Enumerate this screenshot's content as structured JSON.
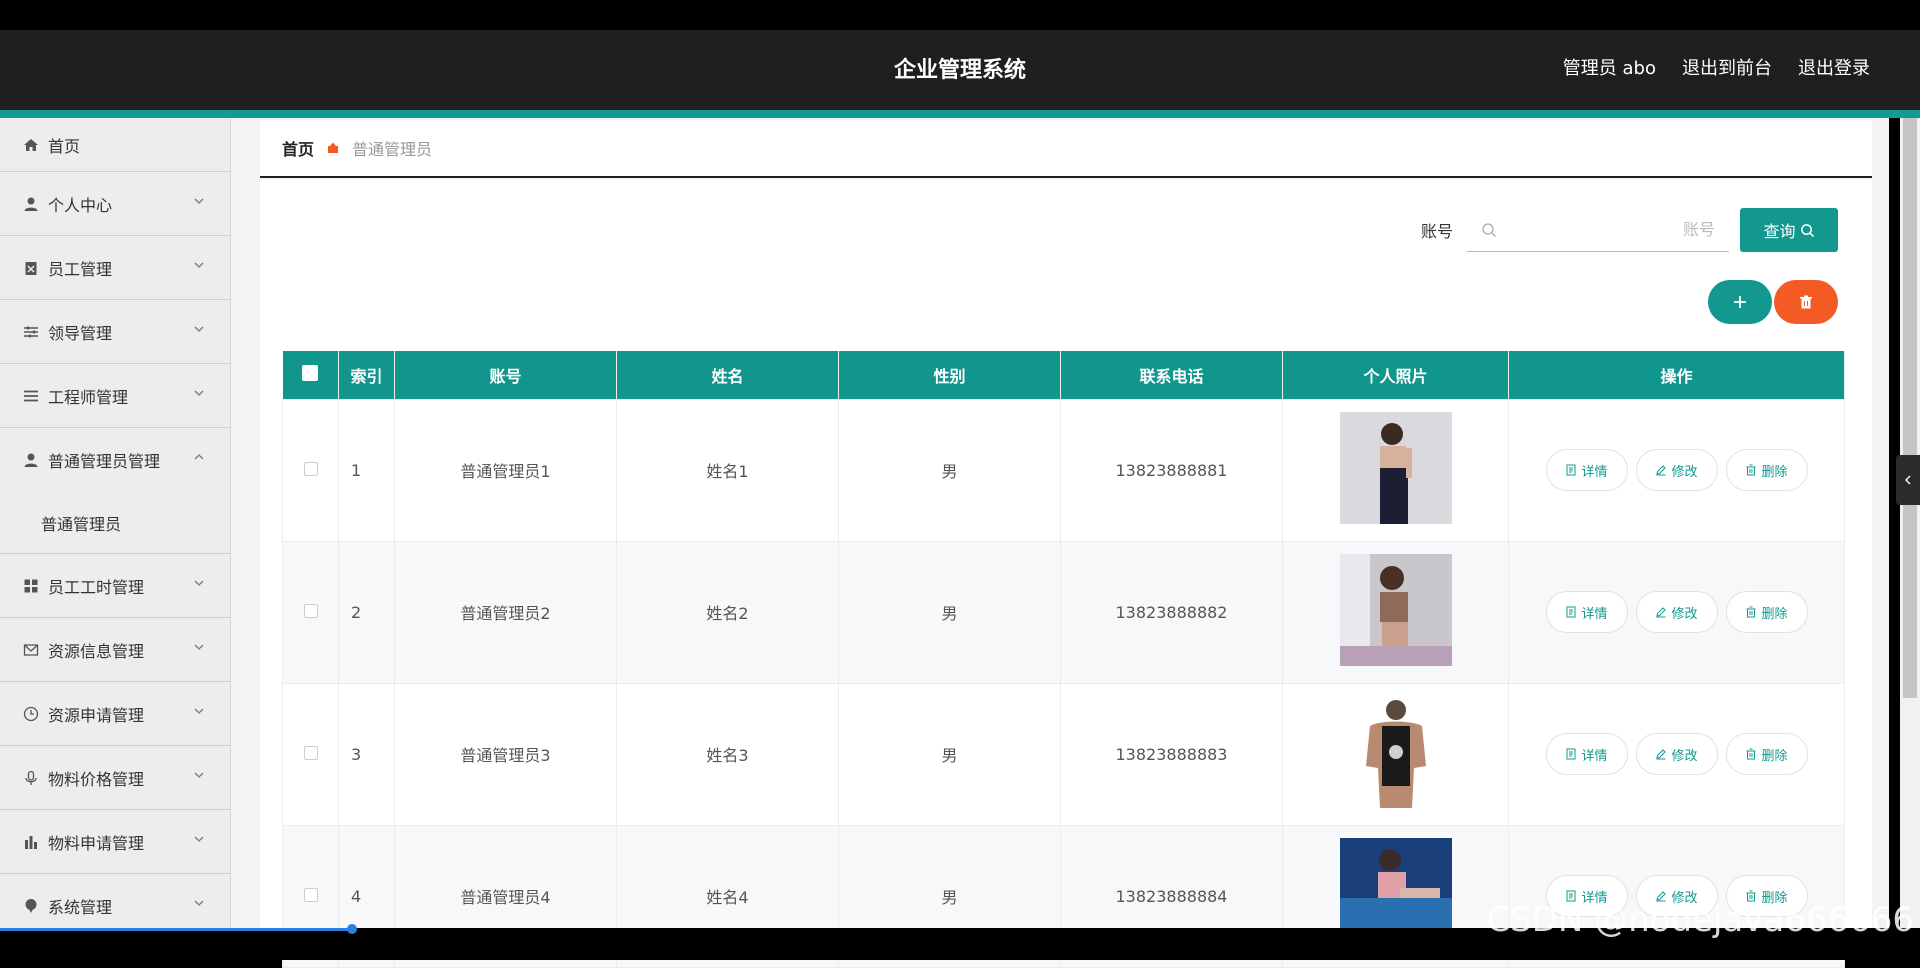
{
  "header": {
    "title": "企业管理系统",
    "user": "管理员 abo",
    "to_front": "退出到前台",
    "logout": "退出登录"
  },
  "sidebar": {
    "items": [
      {
        "label": "首页",
        "icon": "home-icon"
      },
      {
        "label": "个人中心",
        "icon": "user-icon"
      },
      {
        "label": "员工管理",
        "icon": "badge-icon"
      },
      {
        "label": "领导管理",
        "icon": "sliders-icon"
      },
      {
        "label": "工程师管理",
        "icon": "list-icon"
      },
      {
        "label": "普通管理员管理",
        "icon": "user-icon",
        "expanded": true,
        "sub": "普通管理员"
      },
      {
        "label": "员工工时管理",
        "icon": "grid-icon"
      },
      {
        "label": "资源信息管理",
        "icon": "mail-icon"
      },
      {
        "label": "资源申请管理",
        "icon": "clock-icon"
      },
      {
        "label": "物料价格管理",
        "icon": "mic-icon"
      },
      {
        "label": "物料申请管理",
        "icon": "bar-chart-icon"
      },
      {
        "label": "系统管理",
        "icon": "pin-icon"
      }
    ]
  },
  "breadcrumb": {
    "home": "首页",
    "current": "普通管理员"
  },
  "search": {
    "label": "账号",
    "placeholder": "账号",
    "button": "查询"
  },
  "colors": {
    "accent": "#12988e",
    "danger": "#f45a24",
    "header": "#1f1f22"
  },
  "table": {
    "headers": [
      "索引",
      "账号",
      "姓名",
      "性别",
      "联系电话",
      "个人照片",
      "操作"
    ],
    "rows": [
      {
        "index": "1",
        "account": "普通管理员1",
        "name": "姓名1",
        "gender": "男",
        "phone": "13823888881"
      },
      {
        "index": "2",
        "account": "普通管理员2",
        "name": "姓名2",
        "gender": "男",
        "phone": "13823888882"
      },
      {
        "index": "3",
        "account": "普通管理员3",
        "name": "姓名3",
        "gender": "男",
        "phone": "13823888883"
      },
      {
        "index": "4",
        "account": "普通管理员4",
        "name": "姓名4",
        "gender": "男",
        "phone": "13823888884"
      }
    ],
    "ops": {
      "detail": "详情",
      "edit": "修改",
      "delete": "删除"
    }
  },
  "watermark": "CSDN @nodejava666666"
}
